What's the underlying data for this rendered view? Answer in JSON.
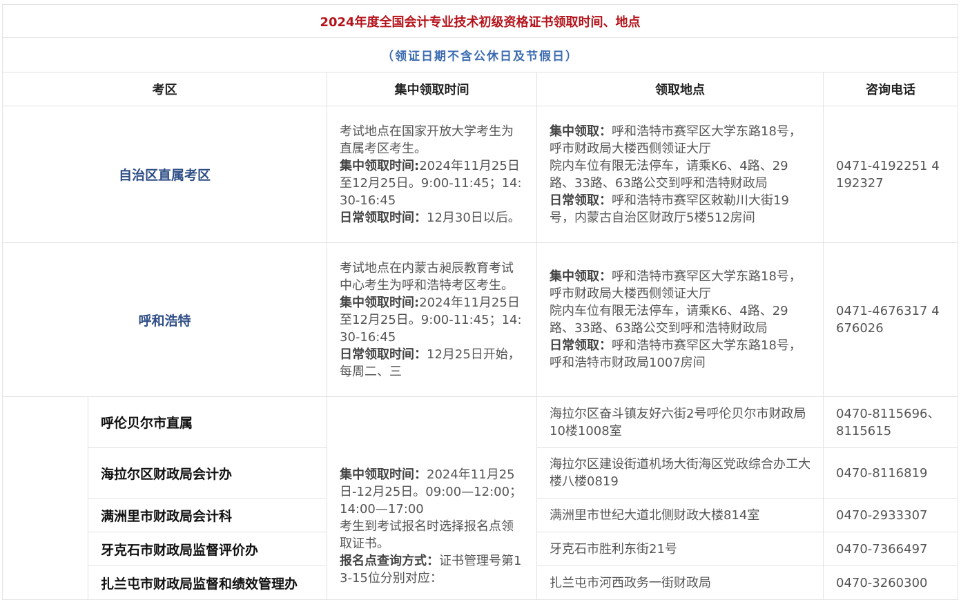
{
  "title": "2024年度全国会计专业技术初级资格证书领取时间、地点",
  "subtitle": "（领证日期不含公休日及节假日）",
  "headers": {
    "region": "考区",
    "time": "集中领取时间",
    "location": "领取地点",
    "phone": "咨询电话"
  },
  "rows": [
    {
      "region": "自治区直属考区",
      "time_intro": "考试地点在国家开放大学考生为直属考区考生。",
      "time_central_label": "集中领取时间:",
      "time_central_value": "2024年11月25日至12月25日。9:00-11:45；14:30-16:45",
      "time_daily_label": "日常领取时间：",
      "time_daily_value": "12月30日以后。",
      "loc_central_label": "集中领取：",
      "loc_central_value": "呼和浩特市赛罕区大学东路18号，呼市财政局大楼西侧领证大厅",
      "loc_note": "院内车位有限无法停车，请乘K6、4路、29路、33路、63路公交到呼和浩特财政局",
      "loc_daily_label": "日常领取：",
      "loc_daily_value": "呼和浩特市赛罕区敕勒川大街19号，内蒙古自治区财政厅5楼512房间",
      "phone": "0471-4192251 4192327"
    },
    {
      "region": "呼和浩特",
      "time_intro": "考试地点在内蒙古昶辰教育考试中心考生为呼和浩特考区考生。",
      "time_central_label": "集中领取时间:",
      "time_central_value": "2024年11月25日至12月25日。9:00-11:45；14:30-16:45",
      "time_daily_label": "日常领取时间：",
      "time_daily_value": "12月25日开始，每周二、三",
      "loc_central_label": "集中领取：",
      "loc_central_value": "呼和浩特市赛罕区大学东路18号，呼市财政局大楼西侧领证大厅",
      "loc_note": "院内车位有限无法停车，请乘K6、4路、29路、33路、63路公交到呼和浩特财政局",
      "loc_daily_label": "日常领取：",
      "loc_daily_value": "呼和浩特市赛罕区大学东路18号，呼和浩特市财政局1007房间",
      "phone": "0471-4676317 4676026"
    }
  ],
  "hulunbuir": {
    "time_central_label": "集中领取时间：",
    "time_central_value": "2024年11月25日-12月25日。09:00—12:00；14:00—17:00",
    "time_note": "考生到考试报名时选择报名点领取证书。",
    "time_query_label": "报名点查询方式：",
    "time_query_value": "证书管理号第13-15位分别对应：",
    "offices": [
      {
        "name": "呼伦贝尔市直属",
        "location": "海拉尔区奋斗镇友好六街2号呼伦贝尔市财政局10楼1008室",
        "phone": "0470-8115696、8115615"
      },
      {
        "name": "海拉尔区财政局会计办",
        "location": "海拉尔区建设街道机场大街海区党政综合办工大楼八楼0819",
        "phone": "0470-8116819"
      },
      {
        "name": "满洲里市财政局会计科",
        "location": "满洲里市世纪大道北侧财政大楼814室",
        "phone": "0470-2933307"
      },
      {
        "name": "牙克石市财政局监督评价办",
        "location": "牙克石市胜利东街21号",
        "phone": "0470-7366497"
      },
      {
        "name": "扎兰屯市财政局监督和绩效管理办",
        "location": "扎兰屯市河西政务一街财政局",
        "phone": "0470-3260300"
      }
    ]
  }
}
